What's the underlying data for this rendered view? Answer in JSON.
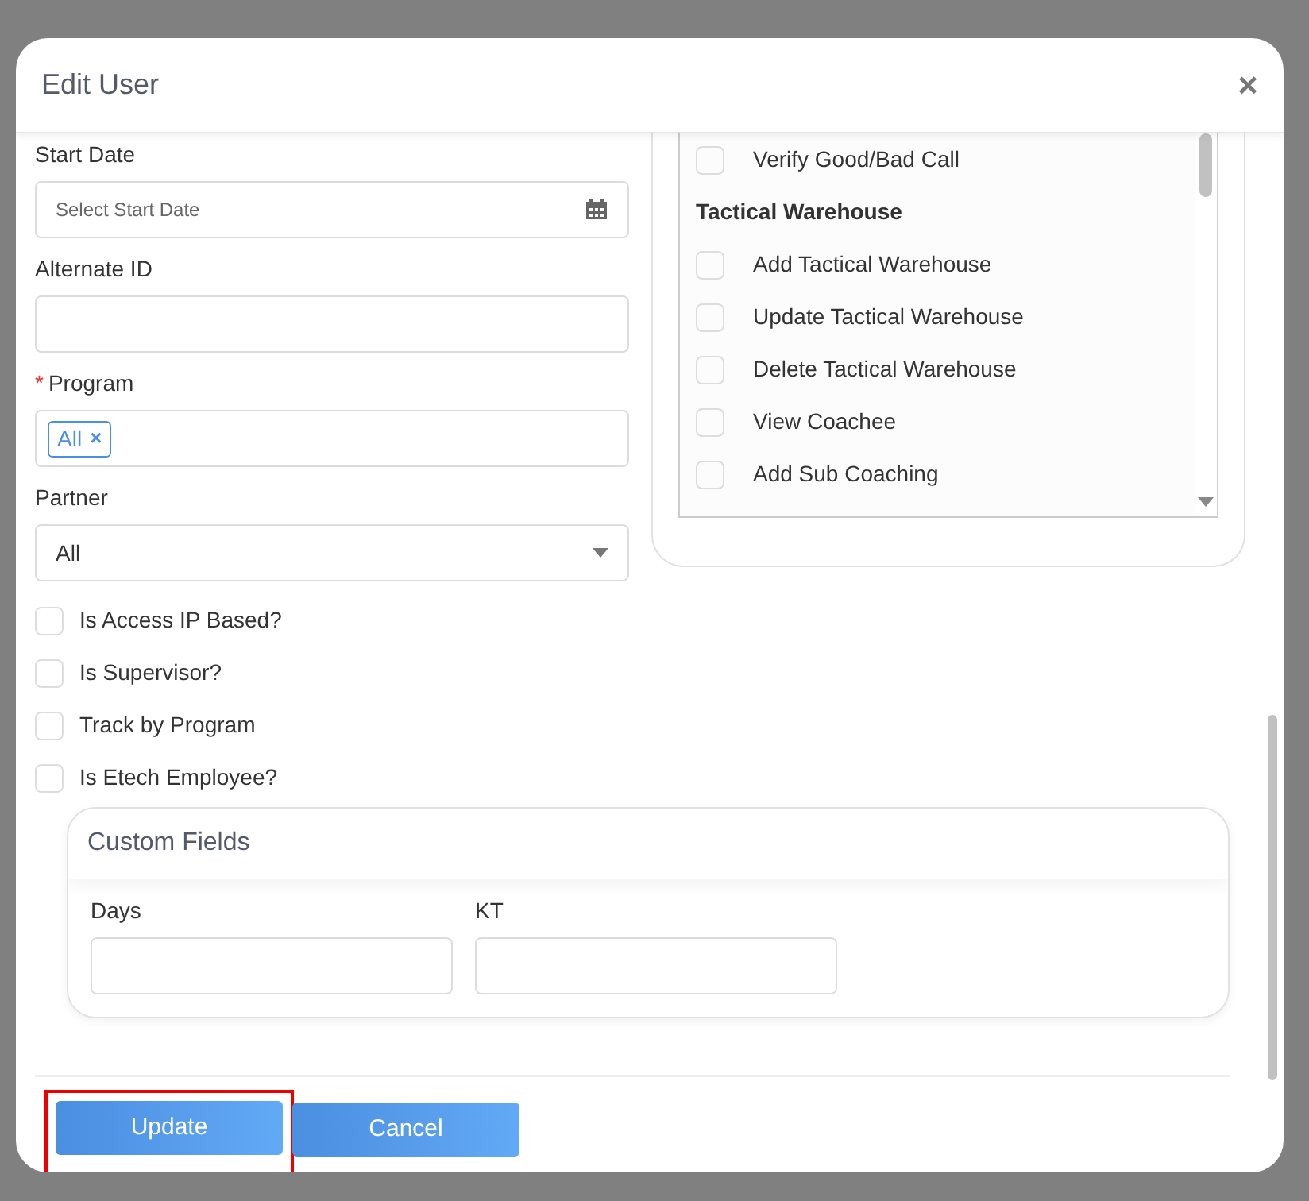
{
  "modal": {
    "title": "Edit User",
    "close": "×"
  },
  "fields": [
    {
      "kind": "date",
      "label": "Start Date",
      "placeholder": "Select Start Date"
    },
    {
      "kind": "text",
      "label": "Alternate ID"
    },
    {
      "kind": "tags",
      "label": "Program",
      "marker": "*",
      "tags": [
        {
          "label": "All",
          "remove": "×"
        }
      ]
    },
    {
      "kind": "select",
      "label": "Partner",
      "value": "All"
    }
  ],
  "options": [
    {
      "label": "Is Access IP Based?",
      "checked": false
    },
    {
      "label": "Is Supervisor?",
      "checked": false
    },
    {
      "label": "Track by Program",
      "checked": false
    },
    {
      "label": "Is Etech Employee?",
      "checked": false
    }
  ],
  "permissions": [
    {
      "kind": "checkbox",
      "label": "Verify Good/Bad Call",
      "checked": false
    },
    {
      "kind": "heading",
      "label": "Tactical Warehouse"
    },
    {
      "kind": "checkbox",
      "label": "Add Tactical Warehouse",
      "checked": false
    },
    {
      "kind": "checkbox",
      "label": "Update Tactical Warehouse",
      "checked": false
    },
    {
      "kind": "checkbox",
      "label": "Delete Tactical Warehouse",
      "checked": false
    },
    {
      "kind": "checkbox",
      "label": "View Coachee",
      "checked": false
    },
    {
      "kind": "checkbox",
      "label": "Add Sub Coaching",
      "checked": false
    }
  ],
  "custom_fields": {
    "title": "Custom Fields",
    "fields": [
      {
        "label": "Days"
      },
      {
        "label": "KT"
      }
    ]
  },
  "buttons": [
    {
      "label": "Update",
      "highlighted": true
    },
    {
      "label": "Cancel",
      "highlighted": false
    }
  ]
}
